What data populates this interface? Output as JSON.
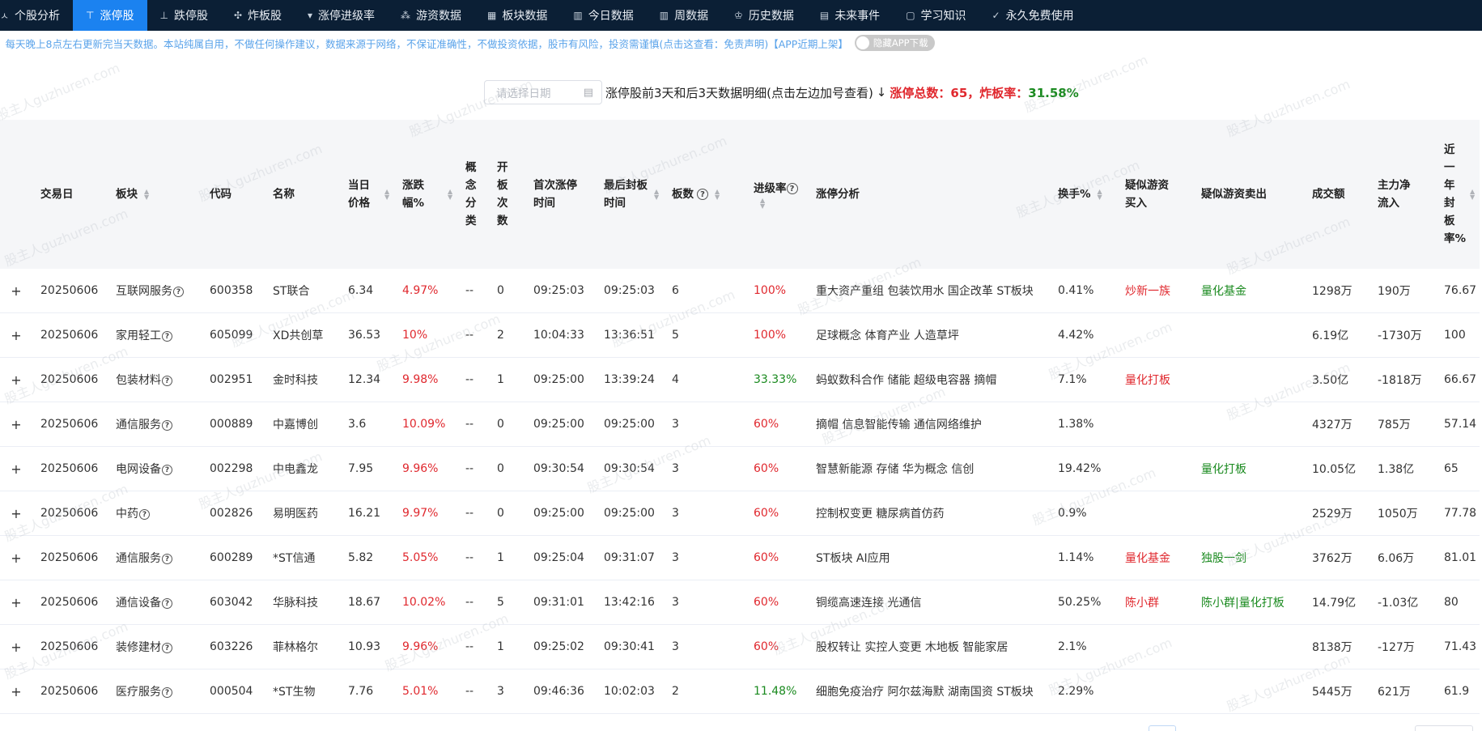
{
  "nav": {
    "items": [
      {
        "icon": "person-icon",
        "glyph": "ㅅ",
        "label": "个股分析",
        "active": false
      },
      {
        "icon": "limit-up-icon",
        "glyph": "⊤",
        "label": "涨停股",
        "active": true
      },
      {
        "icon": "limit-down-icon",
        "glyph": "⊥",
        "label": "跌停股",
        "active": false
      },
      {
        "icon": "broken-board-icon",
        "glyph": "✣",
        "label": "炸板股",
        "active": false
      },
      {
        "icon": "dropdown-icon",
        "glyph": "▾",
        "label": "涨停进级率",
        "active": false
      },
      {
        "icon": "network-icon",
        "glyph": "⁂",
        "label": "游资数据",
        "active": false
      },
      {
        "icon": "grid-icon",
        "glyph": "▦",
        "label": "板块数据",
        "active": false
      },
      {
        "icon": "bar-chart-icon",
        "glyph": "▥",
        "label": "今日数据",
        "active": false
      },
      {
        "icon": "bar-chart-icon",
        "glyph": "▥",
        "label": "周数据",
        "active": false
      },
      {
        "icon": "crown-icon",
        "glyph": "♔",
        "label": "历史数据",
        "active": false
      },
      {
        "icon": "document-icon",
        "glyph": "▤",
        "label": "未来事件",
        "active": false
      },
      {
        "icon": "note-icon",
        "glyph": "▢",
        "label": "学习知识",
        "active": false
      },
      {
        "icon": "check-icon",
        "glyph": "✓",
        "label": "永久免费使用",
        "active": false
      }
    ]
  },
  "notice": {
    "text": "：每天晚上8点左右更新完当天数据。本站纯属自用，不做任何操作建议，数据来源于网络，不保证准确性，不做投资依据，股市有风险，投资需谨慎(点击这查看：免责声明)【APP近期上架】",
    "toggle_label": "隐藏APP下载"
  },
  "titlebar": {
    "date_placeholder": "请选择日期",
    "title": "涨停股前3天和后3天数据明细(点击左边加号查看)",
    "arrow": "↓",
    "total_label": "涨停总数：",
    "total_value": "65",
    "rate_label": "，炸板率：",
    "rate_value": "31.58%"
  },
  "watermark": "股主人guzhuren.com",
  "table": {
    "columns": [
      {
        "key": "expand",
        "label": "",
        "sort": false
      },
      {
        "key": "date",
        "label": "交易日",
        "sort": false
      },
      {
        "key": "sector",
        "label": "板块",
        "sort": true
      },
      {
        "key": "code",
        "label": "代码",
        "sort": false
      },
      {
        "key": "name",
        "label": "名称",
        "sort": false
      },
      {
        "key": "price",
        "label": "当日价格",
        "sort": true
      },
      {
        "key": "change",
        "label": "涨跌幅%",
        "sort": true
      },
      {
        "key": "concept",
        "label": "概念分类",
        "sort": false
      },
      {
        "key": "opens",
        "label": "开板次数",
        "sort": false
      },
      {
        "key": "first_time",
        "label": "首次涨停时间",
        "sort": false
      },
      {
        "key": "last_time",
        "label": "最后封板时间",
        "sort": true
      },
      {
        "key": "boards",
        "label": "板数",
        "sort": true,
        "help": true
      },
      {
        "key": "advance",
        "label": "进级率",
        "sort": true,
        "help": true
      },
      {
        "key": "analysis",
        "label": "涨停分析",
        "sort": false
      },
      {
        "key": "turnover",
        "label": "换手%",
        "sort": true
      },
      {
        "key": "hot_buy",
        "label": "疑似游资买入",
        "sort": false
      },
      {
        "key": "hot_sell",
        "label": "疑似游资卖出",
        "sort": false
      },
      {
        "key": "volume",
        "label": "成交额",
        "sort": false
      },
      {
        "key": "inflow",
        "label": "主力净流入",
        "sort": false
      },
      {
        "key": "seal_rate",
        "label": "近一年封板率%",
        "sort": true
      }
    ],
    "rows": [
      {
        "date": "20250606",
        "sector": "互联网服务",
        "code": "600358",
        "name": "ST联合",
        "price": "6.34",
        "change": "4.97%",
        "concept": "--",
        "opens": "0",
        "first_time": "09:25:03",
        "last_time": "09:25:03",
        "boards": "6",
        "advance": "100%",
        "advance_color": "red",
        "analysis": "重大资产重组 包装饮用水 国企改革 ST板块",
        "turnover": "0.41%",
        "hot_buy": "炒新一族",
        "hot_sell": "量化基金",
        "volume": "1298万",
        "inflow": "190万",
        "seal_rate": "76.67"
      },
      {
        "date": "20250606",
        "sector": "家用轻工",
        "code": "605099",
        "name": "XD共创草",
        "price": "36.53",
        "change": "10%",
        "concept": "--",
        "opens": "2",
        "first_time": "10:04:33",
        "last_time": "13:36:51",
        "boards": "5",
        "advance": "100%",
        "advance_color": "red",
        "analysis": "足球概念 体育产业 人造草坪",
        "turnover": "4.42%",
        "hot_buy": "",
        "hot_sell": "",
        "volume": "6.19亿",
        "inflow": "-1730万",
        "seal_rate": "100"
      },
      {
        "date": "20250606",
        "sector": "包装材料",
        "code": "002951",
        "name": "金时科技",
        "price": "12.34",
        "change": "9.98%",
        "concept": "--",
        "opens": "1",
        "first_time": "09:25:00",
        "last_time": "13:39:24",
        "boards": "4",
        "advance": "33.33%",
        "advance_color": "green",
        "analysis": "蚂蚁数科合作 储能 超级电容器 摘帽",
        "turnover": "7.1%",
        "hot_buy": "量化打板",
        "hot_sell": "",
        "volume": "3.50亿",
        "inflow": "-1818万",
        "seal_rate": "66.67"
      },
      {
        "date": "20250606",
        "sector": "通信服务",
        "code": "000889",
        "name": "中嘉博创",
        "price": "3.6",
        "change": "10.09%",
        "concept": "--",
        "opens": "0",
        "first_time": "09:25:00",
        "last_time": "09:25:00",
        "boards": "3",
        "advance": "60%",
        "advance_color": "red",
        "analysis": "摘帽 信息智能传输 通信网络维护",
        "turnover": "1.38%",
        "hot_buy": "",
        "hot_sell": "",
        "volume": "4327万",
        "inflow": "785万",
        "seal_rate": "57.14"
      },
      {
        "date": "20250606",
        "sector": "电网设备",
        "code": "002298",
        "name": "中电鑫龙",
        "price": "7.95",
        "change": "9.96%",
        "concept": "--",
        "opens": "0",
        "first_time": "09:30:54",
        "last_time": "09:30:54",
        "boards": "3",
        "advance": "60%",
        "advance_color": "red",
        "analysis": "智慧新能源 存储 华为概念 信创",
        "turnover": "19.42%",
        "hot_buy": "",
        "hot_sell": "量化打板",
        "volume": "10.05亿",
        "inflow": "1.38亿",
        "seal_rate": "65"
      },
      {
        "date": "20250606",
        "sector": "中药",
        "code": "002826",
        "name": "易明医药",
        "price": "16.21",
        "change": "9.97%",
        "concept": "--",
        "opens": "0",
        "first_time": "09:25:00",
        "last_time": "09:25:00",
        "boards": "3",
        "advance": "60%",
        "advance_color": "red",
        "analysis": "控制权变更 糖尿病首仿药",
        "turnover": "0.9%",
        "hot_buy": "",
        "hot_sell": "",
        "volume": "2529万",
        "inflow": "1050万",
        "seal_rate": "77.78"
      },
      {
        "date": "20250606",
        "sector": "通信服务",
        "code": "600289",
        "name": "*ST信通",
        "price": "5.82",
        "change": "5.05%",
        "concept": "--",
        "opens": "1",
        "first_time": "09:25:04",
        "last_time": "09:31:07",
        "boards": "3",
        "advance": "60%",
        "advance_color": "red",
        "analysis": "ST板块 AI应用",
        "turnover": "1.14%",
        "hot_buy": "量化基金",
        "hot_sell": "独股一剑",
        "volume": "3762万",
        "inflow": "6.06万",
        "seal_rate": "81.01"
      },
      {
        "date": "20250606",
        "sector": "通信设备",
        "code": "603042",
        "name": "华脉科技",
        "price": "18.67",
        "change": "10.02%",
        "concept": "--",
        "opens": "5",
        "first_time": "09:31:01",
        "last_time": "13:42:16",
        "boards": "3",
        "advance": "60%",
        "advance_color": "red",
        "analysis": "铜缆高速连接 光通信",
        "turnover": "50.25%",
        "hot_buy": "陈小群",
        "hot_sell": "陈小群|量化打板",
        "volume": "14.79亿",
        "inflow": "-1.03亿",
        "seal_rate": "80"
      },
      {
        "date": "20250606",
        "sector": "装修建材",
        "code": "603226",
        "name": "菲林格尔",
        "price": "10.93",
        "change": "9.96%",
        "concept": "--",
        "opens": "1",
        "first_time": "09:25:02",
        "last_time": "09:30:41",
        "boards": "3",
        "advance": "60%",
        "advance_color": "red",
        "analysis": "股权转让 实控人变更 木地板 智能家居",
        "turnover": "2.1%",
        "hot_buy": "",
        "hot_sell": "",
        "volume": "8138万",
        "inflow": "-127万",
        "seal_rate": "71.43"
      },
      {
        "date": "20250606",
        "sector": "医疗服务",
        "code": "000504",
        "name": "*ST生物",
        "price": "7.76",
        "change": "5.01%",
        "concept": "--",
        "opens": "3",
        "first_time": "09:46:36",
        "last_time": "10:02:03",
        "boards": "2",
        "advance": "11.48%",
        "advance_color": "green",
        "analysis": "细胞免疫治疗 阿尔兹海默 湖南国资 ST板块",
        "turnover": "2.29%",
        "hot_buy": "",
        "hot_sell": "",
        "volume": "5445万",
        "inflow": "621万",
        "seal_rate": "61.9"
      }
    ],
    "expand_symbol": "+",
    "help_symbol": "?",
    "sort_up": "▲",
    "sort_down": "▼"
  }
}
